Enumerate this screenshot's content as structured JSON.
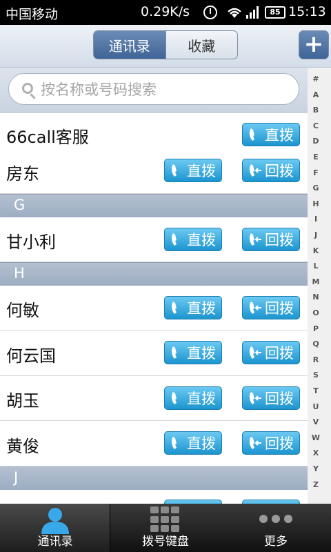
{
  "status_bar": {
    "carrier": "中国移动",
    "speed": "0.29K/s",
    "battery": "85",
    "time": "15:13"
  },
  "header": {
    "tabs": [
      {
        "label": "通讯录",
        "active": true
      },
      {
        "label": "收藏",
        "active": false
      }
    ],
    "add_label": "+"
  },
  "search": {
    "placeholder": "按名称或号码搜索"
  },
  "buttons": {
    "direct": "直拨",
    "callback": "回拨"
  },
  "contacts": {
    "c0": "66call客服",
    "c1": "房东",
    "g0": "甘小利",
    "h0": "何敏",
    "h1": "何云国",
    "h2": "胡玉",
    "h3": "黄俊"
  },
  "sections": {
    "g": "G",
    "h": "H",
    "j": "J"
  },
  "index_letters": [
    "#",
    "A",
    "B",
    "C",
    "D",
    "E",
    "F",
    "G",
    "H",
    "I",
    "J",
    "K",
    "L",
    "M",
    "N",
    "O",
    "P",
    "Q",
    "R",
    "S",
    "T",
    "U",
    "V",
    "W",
    "X",
    "Y",
    "Z"
  ],
  "bottom_nav": [
    {
      "label": "通讯录",
      "active": true
    },
    {
      "label": "拨号键盘",
      "active": false
    },
    {
      "label": "更多",
      "active": false
    }
  ],
  "colors": {
    "accent": "#1c95cf",
    "header_active": "#4f72a3",
    "section": "#a6b5c8"
  }
}
